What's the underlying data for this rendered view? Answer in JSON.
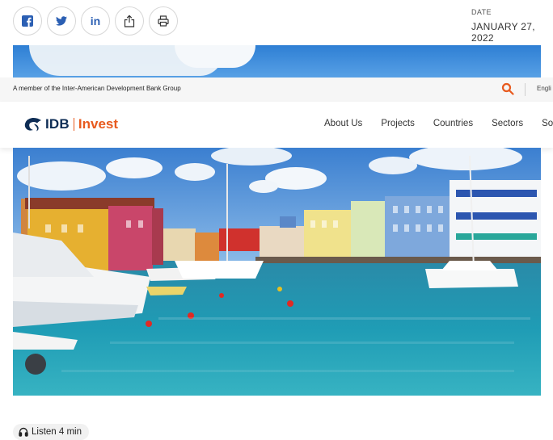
{
  "share": {
    "buttons": [
      {
        "name": "facebook-share-button",
        "icon": "facebook-icon"
      },
      {
        "name": "twitter-share-button",
        "icon": "twitter-icon"
      },
      {
        "name": "linkedin-share-button",
        "icon": "linkedin-icon",
        "label": "in"
      },
      {
        "name": "share-button",
        "icon": "share-icon"
      },
      {
        "name": "print-button",
        "icon": "printer-icon"
      }
    ],
    "icon_color": "#2b5fb3"
  },
  "date": {
    "label": "DATE",
    "value": "JANUARY 27, 2022"
  },
  "topbar": {
    "member_text": "A member of the Inter-American Development Bank Group",
    "language": "Engli",
    "search_icon": "search-icon",
    "accent_color": "#e85a1e"
  },
  "brand": {
    "idb": "IDB",
    "invest": "Invest",
    "navy": "#0e2d55",
    "orange": "#e85a1e"
  },
  "nav": {
    "items": [
      "About Us",
      "Projects",
      "Countries",
      "Sectors",
      "Solu"
    ]
  },
  "hero": {
    "image": "harbor-marina-photo"
  },
  "listen": {
    "icon": "headphones-icon",
    "label": "Listen 4 min"
  }
}
